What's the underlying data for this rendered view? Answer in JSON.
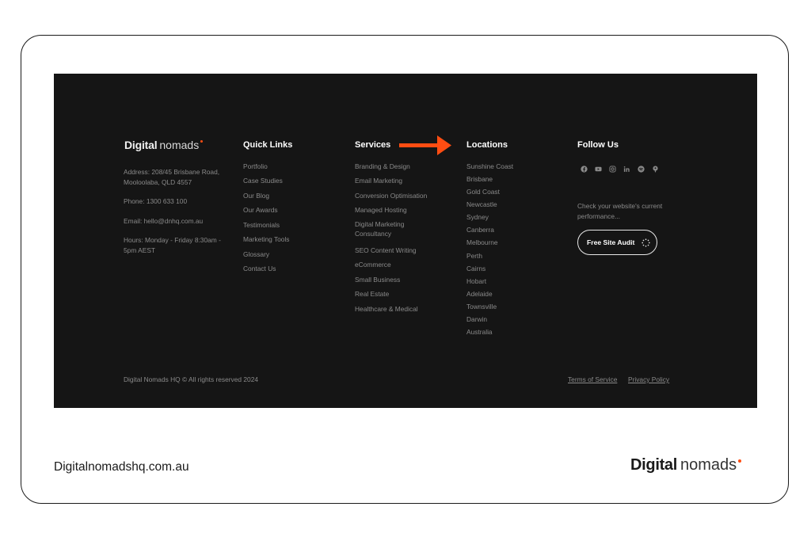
{
  "footer": {
    "logo": {
      "word1": "Digital",
      "word2": "nomads"
    },
    "contact": {
      "address": "Address: 208/45 Brisbane Road, Mooloolaba, QLD 4557",
      "phone": "Phone: 1300 633 100",
      "email": "Email: hello@dnhq.com.au",
      "hours": "Hours: Monday - Friday 8:30am - 5pm AEST"
    },
    "quick_links": {
      "heading": "Quick Links",
      "items": [
        "Portfolio",
        "Case Studies",
        "Our Blog",
        "Our Awards",
        "Testimonials",
        "Marketing Tools",
        "Glossary",
        "Contact Us"
      ]
    },
    "services": {
      "heading": "Services",
      "items": [
        "Branding & Design",
        "Email Marketing",
        "Conversion Optimisation",
        "Managed Hosting",
        "Digital Marketing Consultancy",
        "SEO Content Writing",
        "eCommerce",
        "Small Business",
        "Real Estate",
        "Healthcare & Medical"
      ]
    },
    "locations": {
      "heading": "Locations",
      "items": [
        "Sunshine Coast",
        "Brisbane",
        "Gold Coast",
        "Newcastle",
        "Sydney",
        "Canberra",
        "Melbourne",
        "Perth",
        "Cairns",
        "Hobart",
        "Adelaide",
        "Townsville",
        "Darwin",
        "Australia"
      ]
    },
    "follow": {
      "heading": "Follow Us",
      "icons": [
        "facebook-icon",
        "youtube-icon",
        "instagram-icon",
        "linkedin-icon",
        "spotify-icon",
        "podcast-icon"
      ],
      "performance_text": "Check your website's current performance...",
      "audit_button": "Free Site Audit"
    },
    "copyright": "Digital Nomads HQ © All rights reserved 2024",
    "terms": "Terms of Service",
    "privacy": "Privacy Policy"
  },
  "page": {
    "site_url": "Digitalnomadshq.com.au",
    "brand": {
      "word1": "Digital",
      "word2": "nomads"
    }
  },
  "colors": {
    "footer_bg": "#151515",
    "accent": "#ff4d12",
    "muted_text": "#8a8a8a"
  }
}
